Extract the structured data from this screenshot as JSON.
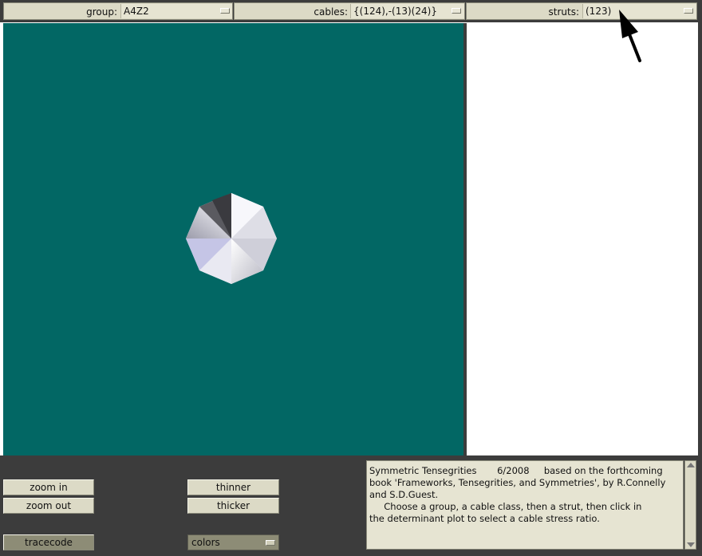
{
  "toolbar": {
    "group": {
      "label": "group:",
      "value": "A4Z2"
    },
    "cables": {
      "label": "cables:",
      "value": "{(124),-(13)(24)}"
    },
    "struts": {
      "label": "struts:",
      "value": "(123)"
    }
  },
  "buttons": {
    "zoom_in": "zoom in",
    "zoom_out": "zoom out",
    "thinner": "thinner",
    "thicker": "thicker",
    "tracecode": "tracecode",
    "colors": "colors"
  },
  "info": {
    "line1": "Symmetric Tensegrities       6/2008     based on the forthcoming",
    "line2": "book 'Frameworks, Tensegrities, and Symmetries', by R.Connelly",
    "line3": "and S.D.Guest.",
    "line4": "     Choose a group, a cable class, then a strut, then click in",
    "line5": "the determinant plot to select a cable stress ratio."
  },
  "colors": {
    "canvas_bg": "#026764",
    "panel_bg": "#3c3c3c",
    "widget_bg": "#dcdac6"
  }
}
